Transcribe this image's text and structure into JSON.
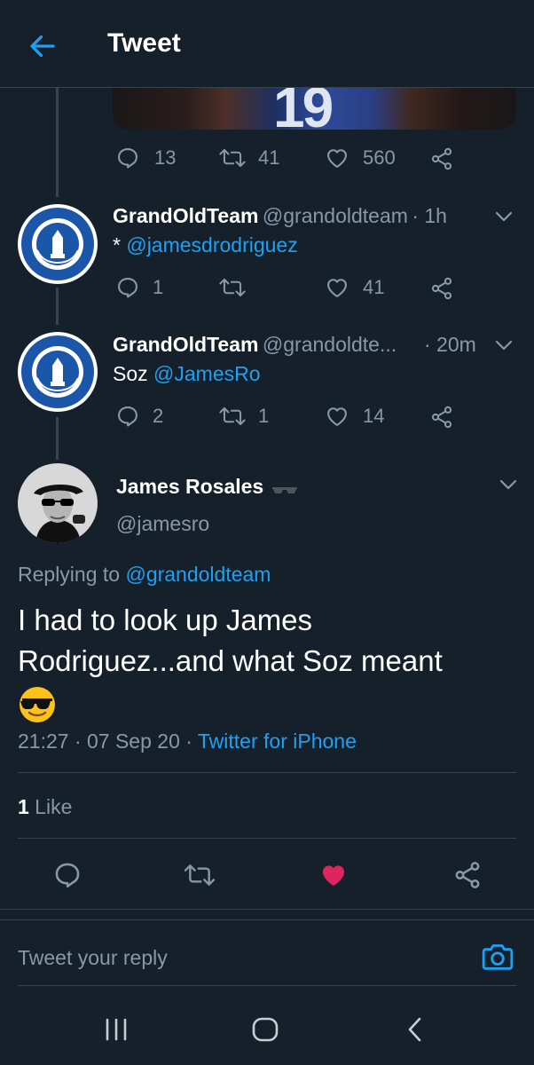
{
  "header": {
    "title": "Tweet"
  },
  "tweet_prev": {
    "replies": "13",
    "retweets": "41",
    "likes": "560"
  },
  "reply1": {
    "name": "GrandOldTeam",
    "handle": "@grandoldteam",
    "time": "· 1h",
    "text_prefix": "* ",
    "text_mention": "@jamesdrodriguez",
    "replies": "1",
    "retweets": "",
    "likes": "41"
  },
  "reply2": {
    "name": "GrandOldTeam",
    "handle": "@grandoldte...",
    "time": "· 20m",
    "text_prefix": "Soz ",
    "text_mention": "@JamesRo",
    "replies": "2",
    "retweets": "1",
    "likes": "14"
  },
  "main": {
    "name": "James Rosales",
    "handle": "@jamesro",
    "replying_label": "Replying to ",
    "replying_handle": "@grandoldteam",
    "text": "I had to look up James Rodriguez...and what Soz meant",
    "time": "21:27 · 07 Sep 20 · ",
    "source": "Twitter for iPhone",
    "like_count": "1",
    "like_label": " Like"
  },
  "compose": {
    "placeholder": "Tweet your reply"
  },
  "icons": [
    "back-arrow-icon",
    "reply-icon",
    "retweet-icon",
    "heart-icon",
    "share-icon",
    "chevron-down-icon",
    "camera-icon",
    "sunglasses-emoji-icon",
    "recents-icon",
    "home-icon",
    "nav-back-icon"
  ],
  "colors": {
    "background": "#15202b",
    "accent": "#1da1f2",
    "muted": "#8899a6",
    "like": "#e0245e"
  }
}
